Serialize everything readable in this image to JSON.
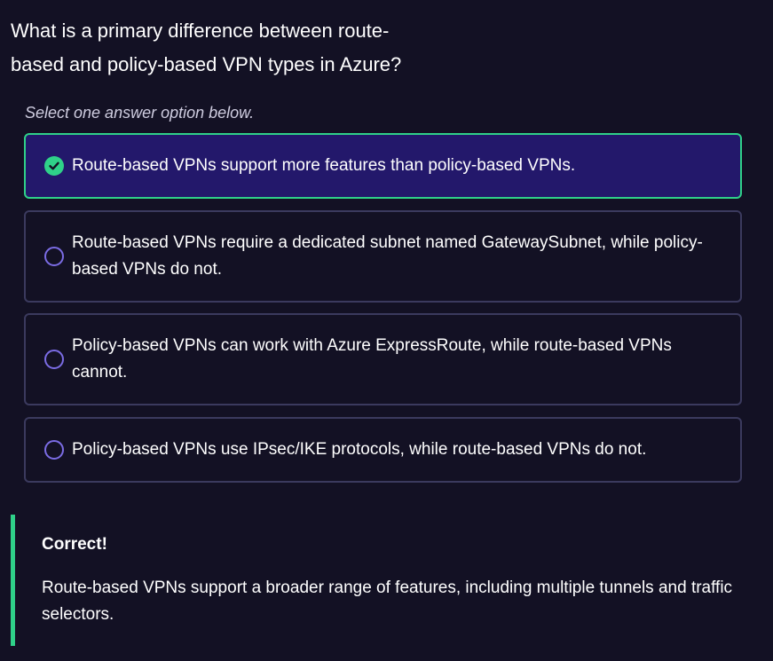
{
  "question": {
    "text": "What is a primary difference between route-based and policy-based VPN types in Azure?"
  },
  "instruction": "Select one answer option below.",
  "options": [
    {
      "label": "Route-based VPNs support more features than policy-based VPNs.",
      "selected": true
    },
    {
      "label": "Route-based VPNs require a dedicated subnet named GatewaySubnet, while policy-based VPNs do not.",
      "selected": false
    },
    {
      "label": "Policy-based VPNs can work with Azure ExpressRoute, while route-based VPNs cannot.",
      "selected": false
    },
    {
      "label": "Policy-based VPNs use IPsec/IKE protocols, while route-based VPNs do not.",
      "selected": false
    }
  ],
  "feedback": {
    "title": "Correct!",
    "text": "Route-based VPNs support a broader range of features, including multiple tunnels and traffic selectors."
  },
  "colors": {
    "background": "#131124",
    "selected_background": "#23186b",
    "correct_accent": "#2fd189",
    "radio_border": "#7b6ce4",
    "option_border": "#3b3a5e"
  },
  "icons": {
    "selected": "check-circle-icon",
    "unselected": "radio-circle-icon"
  }
}
